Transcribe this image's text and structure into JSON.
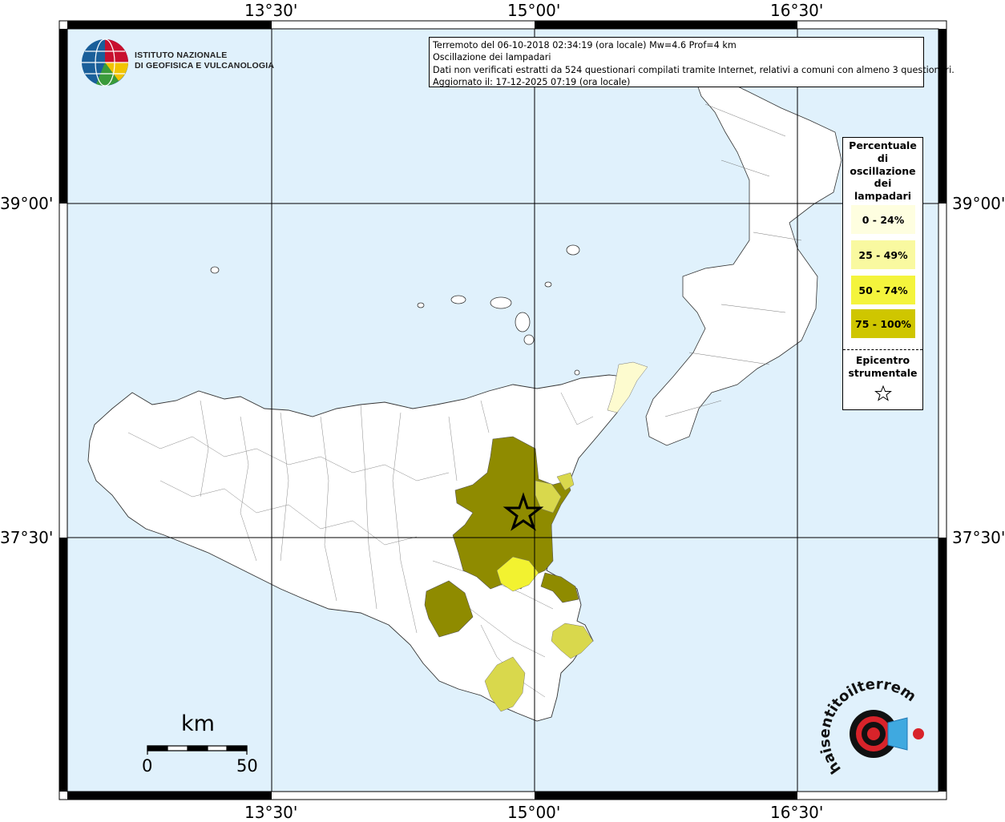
{
  "title_box": {
    "line1": "Terremoto del 06-10-2018 02:34:19 (ora locale) Mw=4.6 Prof=4 km",
    "line2": "Oscillazione dei lampadari",
    "line3": "Dati non verificati estratti da 524 questionari compilati tramite Internet, relativi a comuni con almeno 3 questionari.",
    "line4": "Aggiornato il: 17-12-2025 07:19 (ora locale)"
  },
  "logo": {
    "line1": "ISTITUTO NAZIONALE",
    "line2": "DI GEOFISICA E VULCANOLOGIA"
  },
  "coordinates": {
    "lon_labels": [
      "13°30'",
      "15°00'",
      "16°30'"
    ],
    "lat_labels": [
      "39°00'",
      "37°30'"
    ]
  },
  "legend": {
    "title": "Percentuale di oscillazione dei lampadari",
    "title_lines": [
      "Percentuale",
      "di",
      "oscillazione",
      "dei",
      "lampadari"
    ],
    "classes": [
      {
        "label": "0 - 24%",
        "color": "#fefee0"
      },
      {
        "label": "25 - 49%",
        "color": "#f9f9a0"
      },
      {
        "label": "50 - 74%",
        "color": "#f4f43c"
      },
      {
        "label": "75 - 100%",
        "color": "#cfc600"
      }
    ],
    "epicenter_lines": [
      "Epicentro",
      "strumentale"
    ],
    "epicenter_icon": "star-outline-icon"
  },
  "scale_bar": {
    "unit": "km",
    "min_label": "0",
    "max_label": "50"
  },
  "watermark": {
    "text": "haisentitoilterremoto.it",
    "icon": "seismograph-target-icon"
  },
  "colors": {
    "sea": "#e0f1fc",
    "land": "#ffffff",
    "class_75_100_fill": "#8f8b00",
    "class_50_74_fill": "#f2f230",
    "class_25_49_fill": "#d9d84c",
    "class_0_24_fill": "#fdfbcf"
  }
}
